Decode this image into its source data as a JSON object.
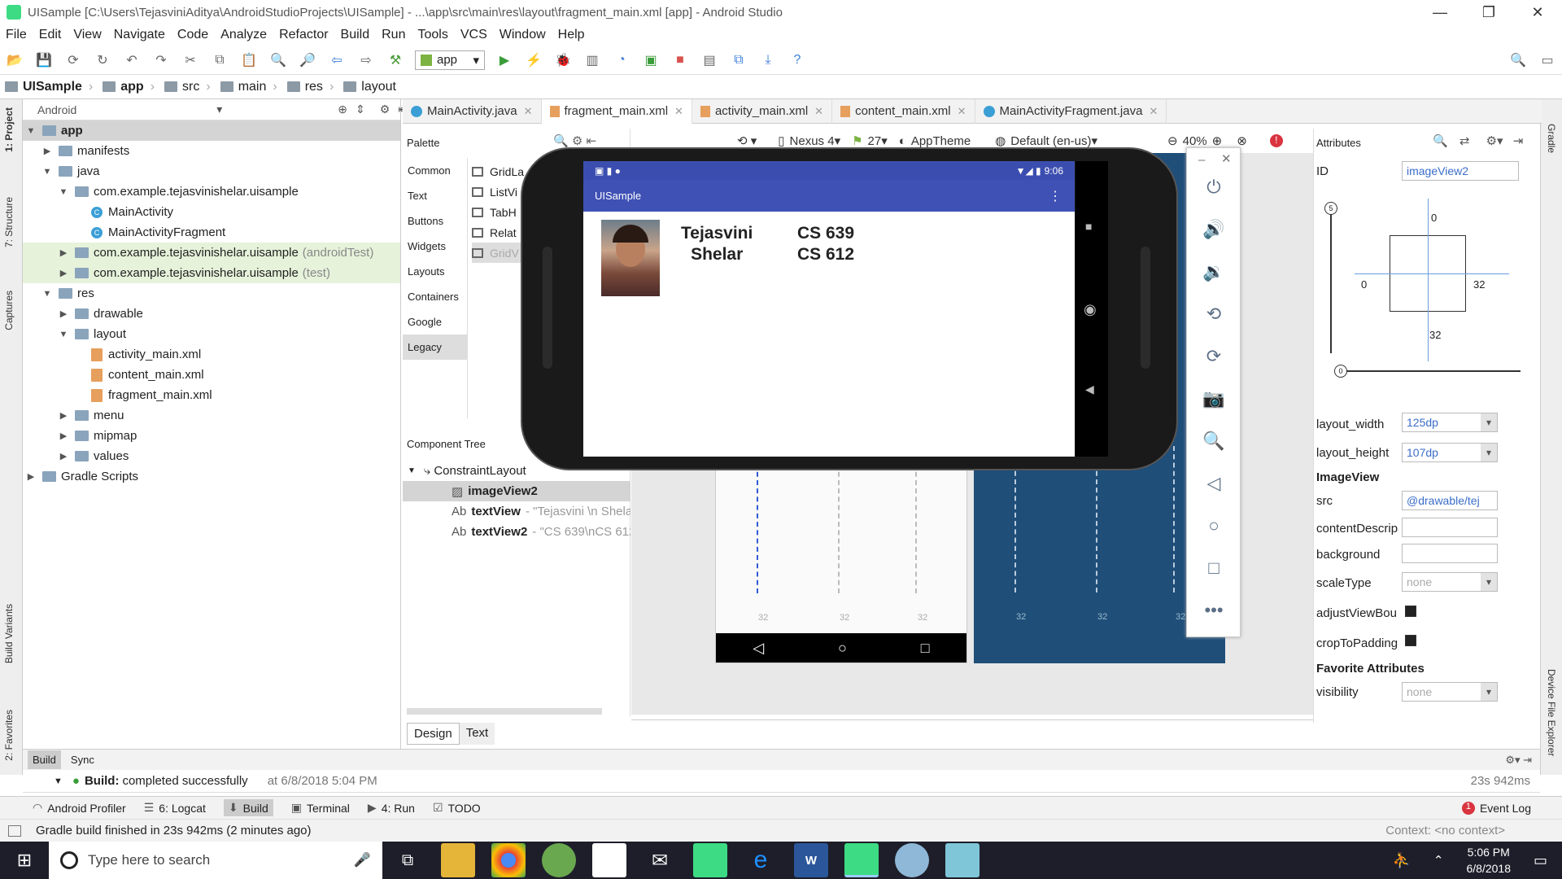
{
  "title": "UISample [C:\\Users\\TejasviniAditya\\AndroidStudioProjects\\UISample] - ...\\app\\src\\main\\res\\layout\\fragment_main.xml [app] - Android Studio",
  "menu": [
    "File",
    "Edit",
    "View",
    "Navigate",
    "Code",
    "Analyze",
    "Refactor",
    "Build",
    "Run",
    "Tools",
    "VCS",
    "Window",
    "Help"
  ],
  "toolbar": {
    "run_config": "app"
  },
  "breadcrumb": [
    "UISample",
    "app",
    "src",
    "main",
    "res",
    "layout"
  ],
  "project": {
    "view": "Android",
    "tree": [
      {
        "label": "app",
        "depth": 0,
        "arrow": "▼",
        "icon": "folder",
        "bold": true,
        "sel": true
      },
      {
        "label": "manifests",
        "depth": 1,
        "arrow": "▶",
        "icon": "folder"
      },
      {
        "label": "java",
        "depth": 1,
        "arrow": "▼",
        "icon": "folder"
      },
      {
        "label": "com.example.tejasvinishelar.uisample",
        "depth": 2,
        "arrow": "▼",
        "icon": "folder"
      },
      {
        "label": "MainActivity",
        "depth": 3,
        "arrow": "",
        "icon": "class"
      },
      {
        "label": "MainActivityFragment",
        "depth": 3,
        "arrow": "",
        "icon": "class"
      },
      {
        "label": "com.example.tejasvinishelar.uisample",
        "suffix": "(androidTest)",
        "depth": 2,
        "arrow": "▶",
        "icon": "folder",
        "hl": true
      },
      {
        "label": "com.example.tejasvinishelar.uisample",
        "suffix": "(test)",
        "depth": 2,
        "arrow": "▶",
        "icon": "folder",
        "hl": true
      },
      {
        "label": "res",
        "depth": 1,
        "arrow": "▼",
        "icon": "folder"
      },
      {
        "label": "drawable",
        "depth": 2,
        "arrow": "▶",
        "icon": "folder"
      },
      {
        "label": "layout",
        "depth": 2,
        "arrow": "▼",
        "icon": "folder"
      },
      {
        "label": "activity_main.xml",
        "depth": 3,
        "arrow": "",
        "icon": "xml"
      },
      {
        "label": "content_main.xml",
        "depth": 3,
        "arrow": "",
        "icon": "xml"
      },
      {
        "label": "fragment_main.xml",
        "depth": 3,
        "arrow": "",
        "icon": "xml"
      },
      {
        "label": "menu",
        "depth": 2,
        "arrow": "▶",
        "icon": "folder"
      },
      {
        "label": "mipmap",
        "depth": 2,
        "arrow": "▶",
        "icon": "folder"
      },
      {
        "label": "values",
        "depth": 2,
        "arrow": "▶",
        "icon": "folder"
      },
      {
        "label": "Gradle Scripts",
        "depth": 0,
        "arrow": "▶",
        "icon": "gradle"
      }
    ]
  },
  "tabs": [
    {
      "label": "MainActivity.java",
      "type": "class"
    },
    {
      "label": "fragment_main.xml",
      "type": "xml",
      "active": true
    },
    {
      "label": "activity_main.xml",
      "type": "xml"
    },
    {
      "label": "content_main.xml",
      "type": "xml"
    },
    {
      "label": "MainActivityFragment.java",
      "type": "class"
    }
  ],
  "palette": {
    "title": "Palette",
    "categories": [
      "Common",
      "Text",
      "Buttons",
      "Widgets",
      "Layouts",
      "Containers",
      "Google",
      "Legacy"
    ],
    "selected": "Legacy",
    "items": [
      "GridLa",
      "ListVi",
      "TabH",
      "Relat",
      "GridV"
    ]
  },
  "component_tree": {
    "title": "Component Tree",
    "root": "ConstraintLayout",
    "items": [
      {
        "name": "imageView2",
        "detail": "",
        "sel": true,
        "icon": "image"
      },
      {
        "name": "textView",
        "detail": "- \"Tejasvini \\n Shela",
        "icon": "Ab"
      },
      {
        "name": "textView2",
        "detail": "- \"CS 639\\nCS 612",
        "icon": "Ab"
      }
    ]
  },
  "design_toolbar": {
    "device": "Nexus 4",
    "api": "27",
    "theme": "AppTheme",
    "locale": "Default (en-us)",
    "zoom": "40%"
  },
  "design_tabs": [
    "Design",
    "Text"
  ],
  "attributes": {
    "title": "Attributes",
    "id_label": "ID",
    "id": "imageView2",
    "constraints": {
      "top": "0",
      "left": "0",
      "right": "32",
      "bottom": "32",
      "bias": "5",
      "hbias": "0"
    },
    "layout_width_label": "layout_width",
    "layout_width": "125dp",
    "layout_height_label": "layout_height",
    "layout_height": "107dp",
    "section": "ImageView",
    "src_label": "src",
    "src": "@drawable/tej",
    "contentDescription_label": "contentDescrip",
    "background_label": "background",
    "scaleType_label": "scaleType",
    "scaleType": "none",
    "adjustViewBounds_label": "adjustViewBou",
    "cropToPadding_label": "cropToPadding",
    "fav_section": "Favorite Attributes",
    "visibility_label": "visibility",
    "visibility": "none"
  },
  "emulator": {
    "status_time": "9:06",
    "app_title": "UISample",
    "name_line1": "Tejasvini",
    "name_line2": "Shelar",
    "course1": "CS 639",
    "course2": "CS 612"
  },
  "blueprint_marks": [
    "32",
    "32",
    "32",
    "32",
    "32",
    "32"
  ],
  "bottom": {
    "tabs": [
      "Build",
      "Sync"
    ],
    "build_label": "Build:",
    "build_status": "completed successfully",
    "build_time": "at 6/8/2018 5:04 PM",
    "duration": "23s 942ms"
  },
  "toolwindows": [
    "Android Profiler",
    "6: Logcat",
    "Build",
    "Terminal",
    "4: Run",
    "TODO"
  ],
  "event_log": "Event Log",
  "event_count": "1",
  "status": {
    "message": "Gradle build finished in 23s 942ms (2 minutes ago)",
    "context": "Context: <no context>"
  },
  "left_strip": [
    "1: Project",
    "7: Structure",
    "Captures",
    "Build Variants",
    "2: Favorites"
  ],
  "right_strip": [
    "Gradle",
    "Device File Explorer"
  ],
  "taskbar": {
    "search": "Type here to search",
    "time": "5:06 PM",
    "date": "6/8/2018"
  }
}
